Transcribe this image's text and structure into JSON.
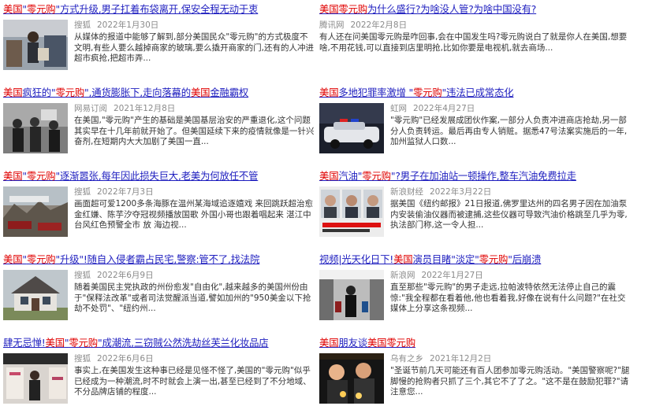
{
  "left": [
    {
      "title_parts": [
        [
          "美国",
          1
        ],
        [
          "\"",
          0
        ],
        [
          "零元购",
          1
        ],
        [
          "\"方式升级,男子扛着布袋离开,保安全程无动于衷",
          0
        ]
      ],
      "source": "搜狐",
      "date": "2022年1月30日",
      "desc": "从媒体的报道中能够了解到,部分美国民众\"零元购\"的方式极度不文明,有些人要么越掉商家的玻璃,要么撬开商家的门,还有的人冲进超市疯抢,把超市弄...",
      "thumb_icon": "store-shopper-photo"
    },
    {
      "title_parts": [
        [
          "美国",
          1
        ],
        [
          "疯狂的\"",
          0
        ],
        [
          "零元购",
          1
        ],
        [
          "\",通货膨胀下,走向落幕的",
          0
        ],
        [
          "美国",
          1
        ],
        [
          "金融霸权",
          0
        ]
      ],
      "source": "网易订阅",
      "date": "2021年12月8日",
      "desc": "在美国,\"零元购\"产生的基础是美国基层治安的严重退化,这个问题其实早在十几年前就开始了。但美国延续下来的疫情就像是一针兴奋剂,在短期内大大加剧了美国一直...",
      "thumb_icon": "looting-crowd-photo"
    },
    {
      "title_parts": [
        [
          "美国",
          1
        ],
        [
          "\"",
          0
        ],
        [
          "零元购",
          1
        ],
        [
          "\"逐渐嚣张,每年因此损失巨大,老美为何放任不管",
          0
        ]
      ],
      "source": "搜狐",
      "date": "2022年7月3日",
      "desc": "画面超可爱1200多条海豚在温州某海域追逐嬉戏 来回跳跃超治愈 金红嫌、陈芋汐夺冠视频播放国歌 外国小哥也跟着唱起来 湛江中台风红色预警全市 放 海边视...",
      "thumb_icon": "ruined-street-photo"
    },
    {
      "title_parts": [
        [
          "美国",
          1
        ],
        [
          "\"",
          0
        ],
        [
          "零元购",
          1
        ],
        [
          "\"升级\"!随自入侵者霸占民宅,警察:管不了,找法院",
          0
        ]
      ],
      "source": "搜狐",
      "date": "2022年6月9日",
      "desc": "随着美国民主党执政的州份愈发\"自由化\",越来越多的美国州份由于\"保释法改革\"或者司法觉醒派当道,譬如加州的\"950美金以下抢劫不处罚\"、\"纽约州...",
      "thumb_icon": "house-photo"
    },
    {
      "title_parts": [
        [
          "肆无忌惮!",
          0
        ],
        [
          "美国",
          1
        ],
        [
          "\"",
          0
        ],
        [
          "零元购",
          1
        ],
        [
          "\"成潮流,三窃贼公然洗劫丝芙兰化妆品店",
          0
        ]
      ],
      "source": "搜狐",
      "date": "2022年6月6日",
      "desc": "事实上,在美国发生这种事已经是见怪不怪了,美国的\"零元购\"似乎已经成为一种潮流,时不时就会上演一出,甚至已经到了不分地域、不分品牌店铺的程度...",
      "thumb_icon": "cosmetics-store-photo"
    }
  ],
  "right": [
    {
      "title_parts": [
        [
          "美国",
          1
        ],
        [
          "零元购",
          1
        ],
        [
          "为什么盛行?为啥没人管?为啥中国没有?",
          0
        ]
      ],
      "source": "腾讯网",
      "date": "2022年2月8日",
      "desc": "有人还在问美国零元购是咋回事,会在中国发生吗?零元购说白了就是你人在美国,想要啥,不用花钱,可以直接到店里明抢,比如你要是电视机,就去商场...",
      "thumb_icon": ""
    },
    {
      "title_parts": [
        [
          "美国",
          1
        ],
        [
          "多地犯罪率激增 \"",
          0
        ],
        [
          "零元购",
          1
        ],
        [
          "\"违法已成常态化",
          0
        ]
      ],
      "source": "虹网",
      "date": "2022年4月27日",
      "desc": "\"零元购\"已经发展成团伙作案,一部分人负责冲进商店抢劫,另一部分人负责转运。最后再由专人销赃。据悉47号法案实施后的一年,加州监狱人口数...",
      "thumb_icon": "police-car-photo"
    },
    {
      "title_parts": [
        [
          "美国",
          1
        ],
        [
          "汽油\"",
          0
        ],
        [
          "零元购",
          1
        ],
        [
          "\"?男子在加油站一顿操作,整车汽油免费拉走",
          0
        ]
      ],
      "source": "新浪财经",
      "date": "2022年3月22日",
      "desc": "据美国《纽约邮报》21日报道,佛罗里达州的四名男子因在加油泵内安装偷油仪器而被逮捕,这些仪器可导致汽油价格跳至几乎为零,执法部门称,这一令人担...",
      "thumb_icon": "mugshots-photo"
    },
    {
      "title_parts": [
        [
          "视频|光天化日下!",
          0
        ],
        [
          "美国",
          1
        ],
        [
          "演员目睹\"淡定\"",
          0
        ],
        [
          "零元购",
          1
        ],
        [
          "\"后崩溃",
          0
        ]
      ],
      "source": "新浪网",
      "date": "2022年1月27日",
      "desc": "直至那些\"零元购\"的男子走远,拉帕波特依然无法停止自己的震惊:\"我全程都在看着他,他也看着我,好像在说有什么问题?\"在社交媒体上分享这条视频...",
      "thumb_icon": "store-aisle-photo"
    },
    {
      "title_parts": [
        [
          "美国",
          1
        ],
        [
          "朋友谈",
          0
        ],
        [
          "美国",
          1
        ],
        [
          "零元购",
          1
        ]
      ],
      "source": "乌有之乡",
      "date": "2021年12月2日",
      "desc": "\"圣诞节前几天可能还有百人团参加零元购活动。\"美国警察呢?\"腿脚慢的抢购者只抓了三个,其它不了了之。\"这不是在鼓励犯罪?\"请注意您...",
      "thumb_icon": "candle-vigil-photo"
    }
  ]
}
